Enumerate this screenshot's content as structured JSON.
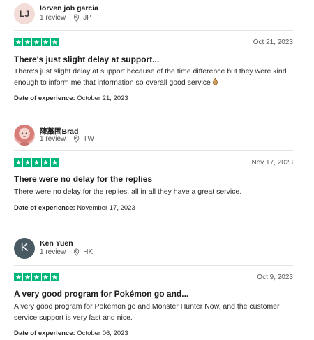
{
  "reviews": [
    {
      "avatar_initials": "LJ",
      "name": "lorven job garcia",
      "review_count": "1 review",
      "country": "JP",
      "rating": 5,
      "date": "Oct 21, 2023",
      "title": "There's just slight delay at support...",
      "body": "There's just slight delay at support because of the time difference but they were kind enough to inform me that information so overall good service",
      "emoji": "ok-hand-emoji",
      "experience_label": "Date of experience:",
      "experience_date": "October 21, 2023"
    },
    {
      "avatar_initials": "",
      "name": "陳藁囿Brad",
      "review_count": "1 review",
      "country": "TW",
      "rating": 5,
      "date": "Nov 17, 2023",
      "title": "There were no delay for the replies",
      "body": "There were no delay for the replies, all in all they have a great service.",
      "experience_label": "Date of experience:",
      "experience_date": "November 17, 2023"
    },
    {
      "avatar_initials": "K",
      "name": "Ken Yuen",
      "review_count": "1 review",
      "country": "HK",
      "rating": 5,
      "date": "Oct 9, 2023",
      "title": "A very good program for Pokémon go and...",
      "body": "A very good program for Pokémon go and Monster Hunter Now, and the customer service support is very fast and nice.",
      "experience_label": "Date of experience:",
      "experience_date": "October 06, 2023"
    }
  ],
  "colors": {
    "star_green": "#00b67a",
    "divider": "#e6e6e6"
  }
}
